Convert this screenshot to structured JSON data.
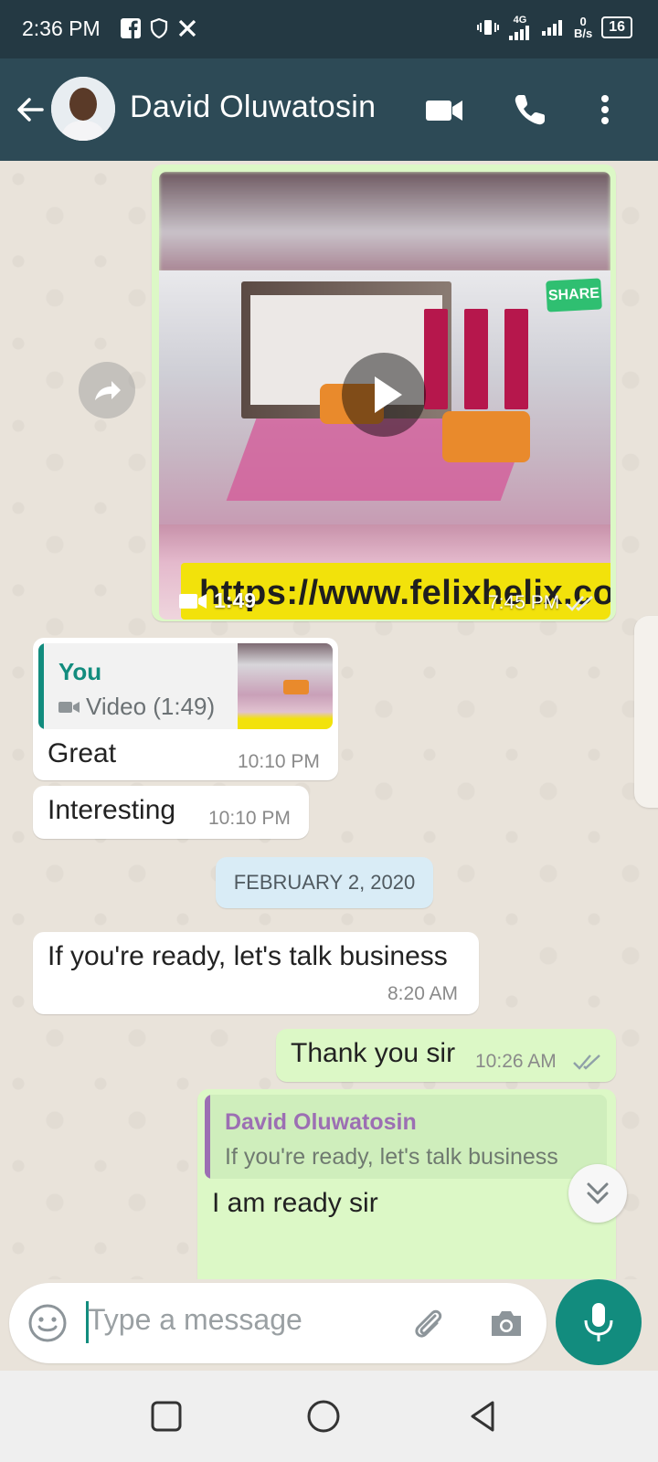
{
  "status_bar": {
    "time": "2:36 PM",
    "network": "4G",
    "speed_value": "0",
    "speed_unit": "B/s",
    "battery": "16"
  },
  "header": {
    "contact_name": "David Oluwatosin",
    "icons": [
      "back-arrow-icon",
      "video-call-icon",
      "phone-icon",
      "more-vert-icon"
    ]
  },
  "messages": {
    "video": {
      "duration": "1:49",
      "time": "7:45 PM",
      "url_overlay": "https://www.felixhelix.com",
      "share_badge": "SHARE"
    },
    "great": {
      "quote_author": "You",
      "quote_text": "Video (1:49)",
      "text": "Great",
      "time": "10:10 PM"
    },
    "interesting": {
      "text": "Interesting",
      "time": "10:10 PM"
    },
    "date_separator": "FEBRUARY 2, 2020",
    "business": {
      "text": "If you're ready, let's talk business",
      "time": "8:20 AM"
    },
    "thanks": {
      "text": "Thank you sir",
      "time": "10:26 AM"
    },
    "ready": {
      "quote_author": "David Oluwatosin",
      "quote_text": "If you're ready, let's talk business",
      "text": "I am ready sir"
    }
  },
  "input": {
    "placeholder": "Type a message"
  },
  "colors": {
    "header_bg": "#2d4a56",
    "status_bg": "#243943",
    "outgoing_bubble": "#dcf8c6",
    "incoming_bubble": "#ffffff",
    "accent": "#128c7e",
    "read_ticks": "#8fa0a8",
    "quote_you": "#128c7e",
    "quote_david": "#9c6fb3"
  }
}
